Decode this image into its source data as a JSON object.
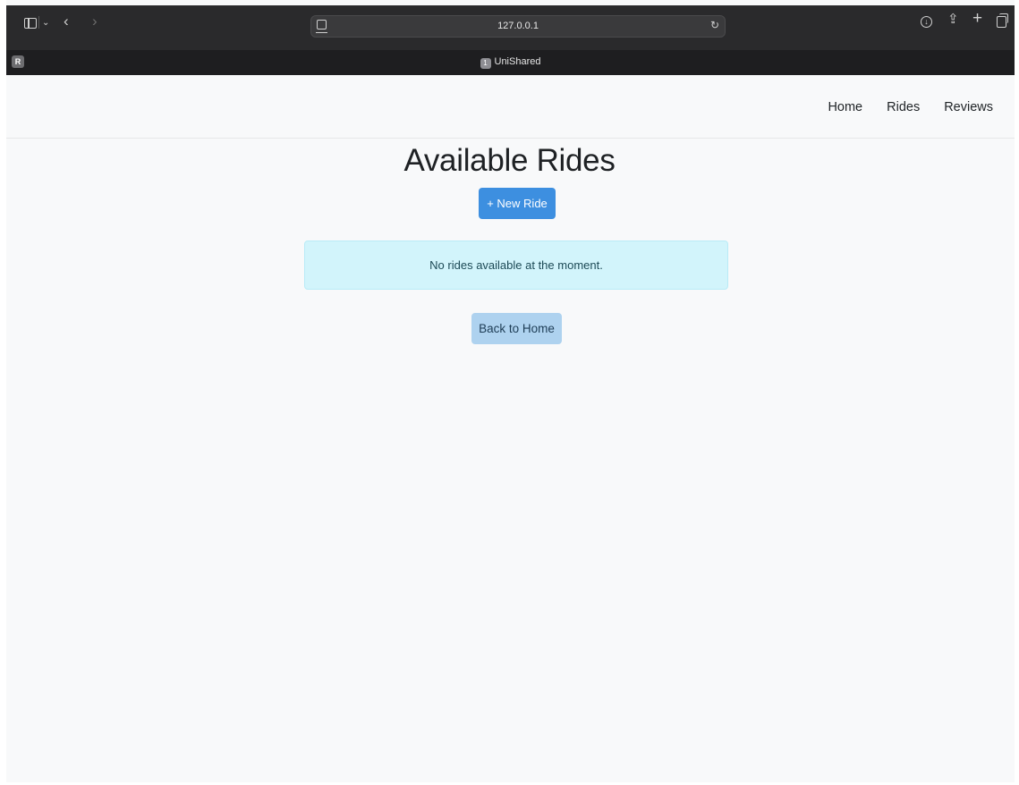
{
  "browser": {
    "url": "127.0.0.1",
    "tab_title": "UniShared",
    "tab_badge": "1",
    "profile_letter": "R"
  },
  "navbar": {
    "links": [
      "Home",
      "Rides",
      "Reviews"
    ]
  },
  "main": {
    "title": "Available Rides",
    "new_ride_label": "+ New Ride",
    "empty_message": "No rides available at the moment.",
    "back_label": "Back to Home"
  },
  "colors": {
    "primary_button": "#3d8fe0",
    "alert_info_bg": "#d2f4fb",
    "secondary_button": "#aed2ef",
    "page_background": "#f8f9fa"
  },
  "icons": [
    "sidebar-icon",
    "chevron-down-icon",
    "back-arrow-icon",
    "forward-arrow-icon",
    "site-icon",
    "reload-icon",
    "download-icon",
    "share-icon",
    "new-tab-icon",
    "tab-overview-icon"
  ]
}
